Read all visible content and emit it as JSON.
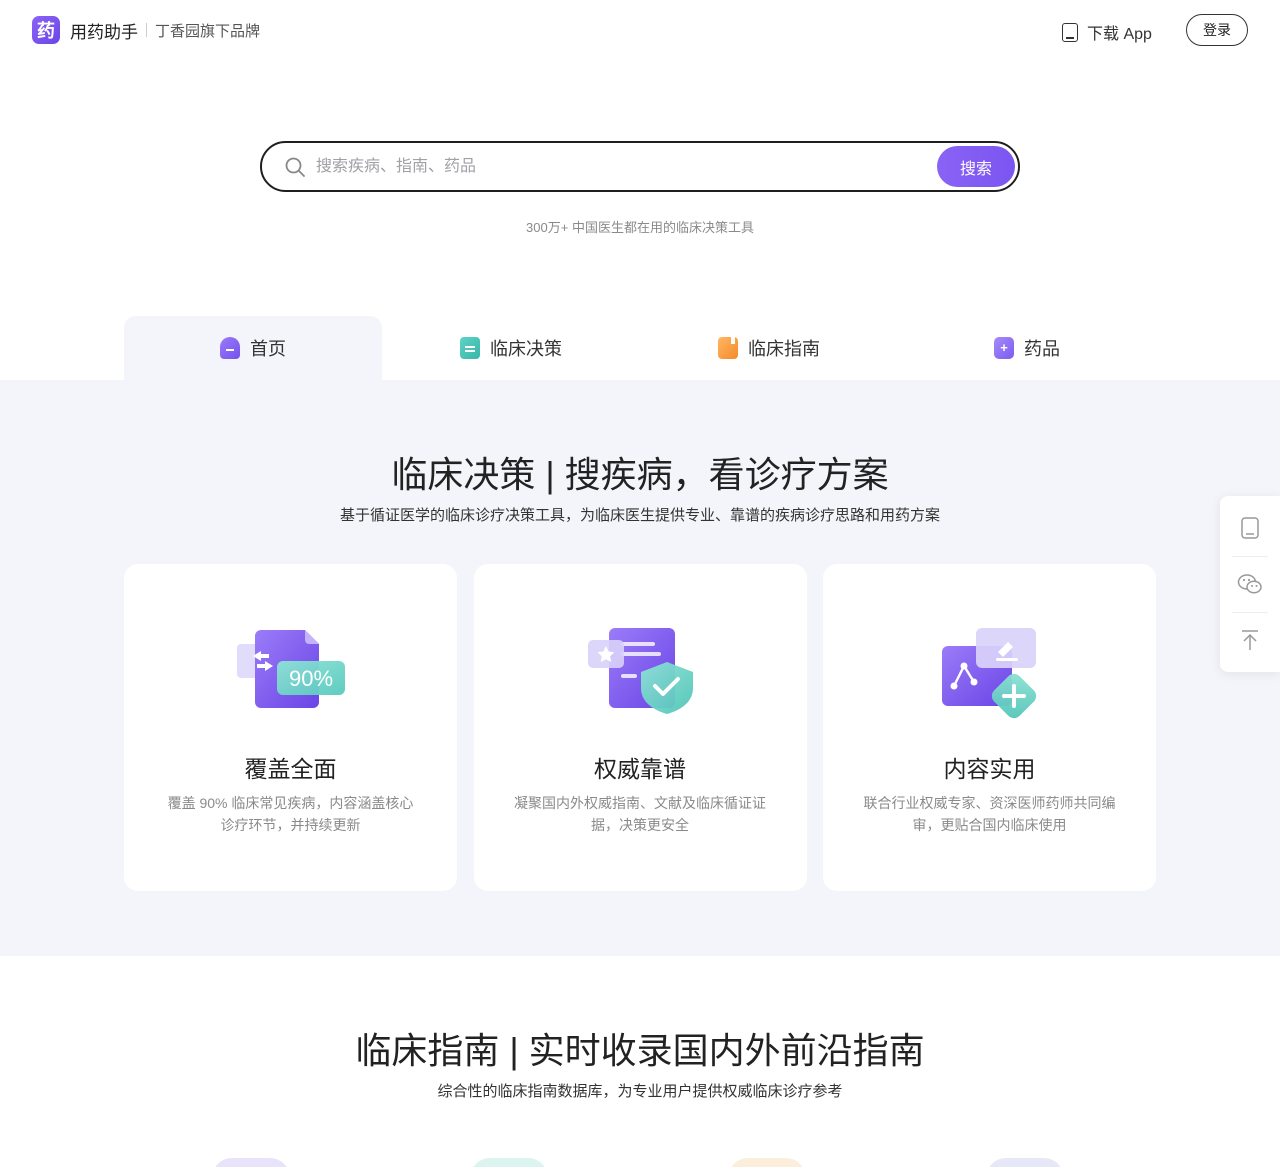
{
  "header": {
    "logo_char": "药",
    "brand_name": "用药助手",
    "brand_sub": "丁香园旗下品牌",
    "download_label": "下载 App",
    "login_label": "登录"
  },
  "search": {
    "placeholder": "搜索疾病、指南、药品",
    "button_label": "搜索",
    "tagline": "300万+ 中国医生都在用的临床决策工具"
  },
  "tabs": [
    {
      "label": "首页",
      "icon": "home-icon",
      "active": true
    },
    {
      "label": "临床决策",
      "icon": "medkit-icon",
      "active": false
    },
    {
      "label": "临床指南",
      "icon": "book-icon",
      "active": false
    },
    {
      "label": "药品",
      "icon": "medicine-bottle-icon",
      "active": false
    }
  ],
  "section1": {
    "title": "临床决策 | 搜疾病，看诊疗方案",
    "subtitle": "基于循证医学的临床诊疗决策工具，为临床医生提供专业、靠谱的疾病诊疗思路和用药方案",
    "cards": [
      {
        "badge": "90%",
        "title": "覆盖全面",
        "desc": "覆盖 90% 临床常见疾病，内容涵盖核心诊疗环节，并持续更新",
        "icon": "coverage-doc-icon"
      },
      {
        "title": "权威靠谱",
        "desc": "凝聚国内外权威指南、文献及临床循证证据，决策更安全",
        "icon": "shield-check-icon"
      },
      {
        "title": "内容实用",
        "desc": "联合行业权威专家、资深医师药师共同编审，更贴合国内临床使用",
        "icon": "medical-plus-icon"
      }
    ]
  },
  "section2": {
    "title": "临床指南 | 实时收录国内外前沿指南",
    "subtitle": "综合性的临床指南数据库，为专业用户提供权威临床诊疗参考"
  },
  "side_toolbar": {
    "items": [
      "tablet-icon",
      "wechat-icon",
      "back-to-top-icon"
    ]
  },
  "colors": {
    "accent": "#7a55f0",
    "section_bg": "#f4f5fa",
    "teal": "#3ec1b3",
    "orange": "#f5922f"
  }
}
